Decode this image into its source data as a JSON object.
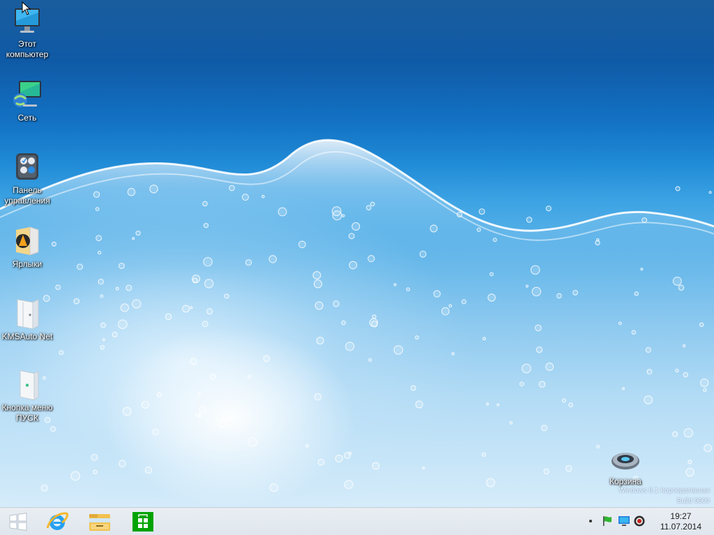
{
  "desktop": {
    "icons": [
      {
        "label": "Этот компьютер",
        "icon": "computer-icon"
      },
      {
        "label": "Сеть",
        "icon": "network-icon"
      },
      {
        "label": "Панель управления",
        "icon": "control-panel-icon"
      },
      {
        "label": "Ярлыки",
        "icon": "shortcuts-folder-icon"
      },
      {
        "label": "KMSAuto Net",
        "icon": "folder-icon"
      },
      {
        "label": "Кнопка меню ПУСК",
        "icon": "folder-icon"
      },
      {
        "label": "Корзина",
        "icon": "recycle-bin-icon"
      }
    ],
    "watermark": {
      "line1": "Windows 8.1 Корпоративная",
      "line2": "Build 9600"
    }
  },
  "taskbar": {
    "pinned": [
      {
        "name": "start",
        "icon": "windows-logo-icon"
      },
      {
        "name": "internet-explorer",
        "icon": "internet-explorer-icon"
      },
      {
        "name": "file-explorer",
        "icon": "file-explorer-icon"
      },
      {
        "name": "store",
        "icon": "windows-store-icon"
      }
    ],
    "tray": {
      "icons": [
        "show-hidden-icon",
        "action-center-flag-icon",
        "network-monitor-icon",
        "volume-icon"
      ],
      "time": "19:27",
      "date": "11.07.2014"
    }
  },
  "colors": {
    "taskbar_bg": "#e4eaf0",
    "store_green": "#00a300",
    "ie_blue": "#1e88e5",
    "flag_green": "#2fb52f"
  }
}
